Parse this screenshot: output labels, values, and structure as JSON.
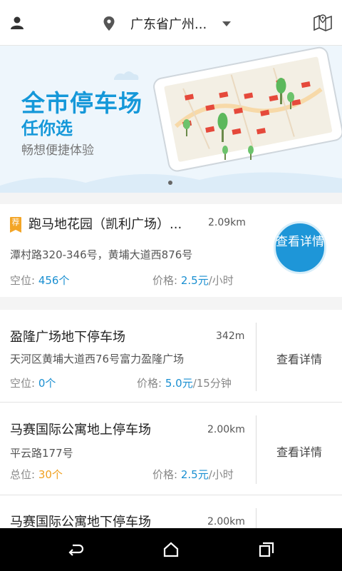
{
  "header": {
    "location": "广东省广州...",
    "icons": [
      "user-icon",
      "location-pin-icon",
      "dropdown-caret-icon",
      "map-icon"
    ]
  },
  "banner": {
    "headline": "全市停车场",
    "subhead": "任你选",
    "tagline": "畅想便捷体验",
    "pager_active": 1,
    "pager_total": 1
  },
  "featured": {
    "badge": "荐",
    "name": "跑马地花园（凯利广场）...",
    "distance": "2.09km",
    "address": "潭村路320-346号，黄埔大道西876号",
    "space_label": "空位:",
    "space_value": "456个",
    "price_label": "价格:",
    "price_value": "2.5元",
    "price_unit": "/小时",
    "button": "查看详情"
  },
  "lots": [
    {
      "name": "盈隆广场地下停车场",
      "distance": "342m",
      "address": "天河区黄埔大道西76号富力盈隆广场",
      "space_label": "空位:",
      "space_value": "0个",
      "price_label": "价格:",
      "price_value": "5.0元",
      "price_unit": "/15分钟",
      "link": "查看详情"
    },
    {
      "name": "马赛国际公寓地上停车场",
      "distance": "2.00km",
      "address": "平云路177号",
      "space_label": "总位:",
      "space_value": "30个",
      "price_label": "价格:",
      "price_value": "2.5元",
      "price_unit": "/小时",
      "link": "查看详情"
    },
    {
      "name": "马赛国际公寓地下停车场",
      "distance": "2.00km"
    }
  ],
  "colors": {
    "accent": "#1a8fd1",
    "badge": "#f3a527",
    "total_value": "#f0a020"
  }
}
